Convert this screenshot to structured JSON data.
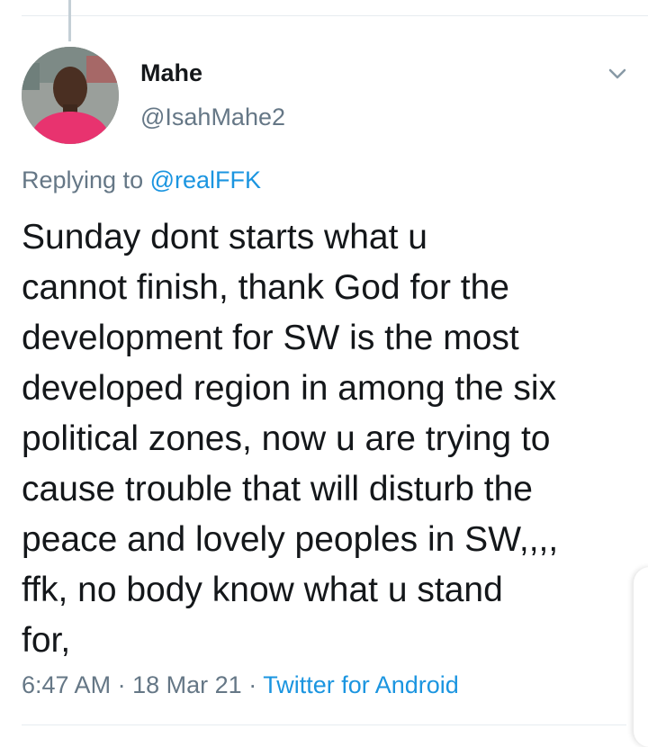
{
  "tweet": {
    "author": {
      "display_name": "Mahe",
      "handle": "@IsahMahe2"
    },
    "replying_to_prefix": "Replying to",
    "replying_to_handle": "@realFFK",
    "text_lines": [
      "Sunday dont starts what u",
      "cannot finish, thank God for the",
      "development for SW is the most",
      "developed region in among the six",
      "political zones, now u are trying to",
      "cause trouble that will disturb the",
      "peace and lovely peoples in SW,,,,",
      "ffk, no body know what u stand",
      "for,"
    ],
    "time": "6:47 AM",
    "date": "18 Mar 21",
    "separator": "·",
    "source": "Twitter for Android"
  },
  "icons": {
    "more_menu": "chevron-down-icon",
    "avatar": "profile-photo"
  },
  "colors": {
    "text_primary": "#14171a",
    "text_secondary": "#657786",
    "link": "#1b95e0",
    "divider": "#e6ecf0",
    "thread_line": "#c4cfd6",
    "avatar_shirt": "#e8336f"
  }
}
